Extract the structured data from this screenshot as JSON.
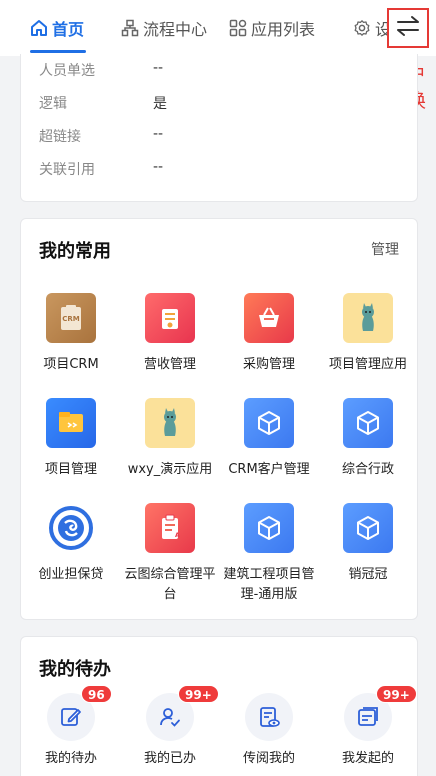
{
  "nav": {
    "tabs": [
      {
        "label": "首页",
        "icon": "home-icon"
      },
      {
        "label": "流程中心",
        "icon": "flow-icon"
      },
      {
        "label": "应用列表",
        "icon": "grid-icon"
      },
      {
        "label": "设",
        "icon": "gear-icon"
      }
    ],
    "switch_icon": "switch-arrows-icon",
    "portal_note": "门户切换"
  },
  "form_info": {
    "rows": [
      {
        "label": "人员单选",
        "value": "--"
      },
      {
        "label": "逻辑",
        "value": "是"
      },
      {
        "label": "超链接",
        "value": "--"
      },
      {
        "label": "关联引用",
        "value": "--"
      }
    ]
  },
  "favorites": {
    "title": "我的常用",
    "manage": "管理",
    "apps": [
      {
        "label": "项目CRM",
        "icon": "crm-icon"
      },
      {
        "label": "营收管理",
        "icon": "revenue-icon"
      },
      {
        "label": "采购管理",
        "icon": "basket-icon"
      },
      {
        "label": "项目管理应用",
        "icon": "cat-icon"
      },
      {
        "label": "项目管理",
        "icon": "folder-icon"
      },
      {
        "label": "wxy_演示应用",
        "icon": "cat-icon"
      },
      {
        "label": "CRM客户管理",
        "icon": "cube-icon"
      },
      {
        "label": "综合行政",
        "icon": "cube-icon"
      },
      {
        "label": "创业担保贷",
        "icon": "ring-logo-icon"
      },
      {
        "label": "云图综合管理平台",
        "icon": "clipboard-icon"
      },
      {
        "label": "建筑工程项目管理-通用版",
        "icon": "cube-icon"
      },
      {
        "label": "销冠冠",
        "icon": "cube-icon"
      }
    ]
  },
  "todos": {
    "title": "我的待办",
    "items": [
      {
        "label": "我的待办",
        "badge": "96",
        "icon": "edit-icon"
      },
      {
        "label": "我的已办",
        "badge": "99+",
        "icon": "user-check-icon"
      },
      {
        "label": "传阅我的",
        "badge": "",
        "icon": "doc-eye-icon"
      },
      {
        "label": "我发起的",
        "badge": "99+",
        "icon": "send-doc-icon"
      }
    ]
  },
  "colors": {
    "accent": "#1f6fe5",
    "badge": "#ef3b3b",
    "annotation": "#e53935"
  }
}
